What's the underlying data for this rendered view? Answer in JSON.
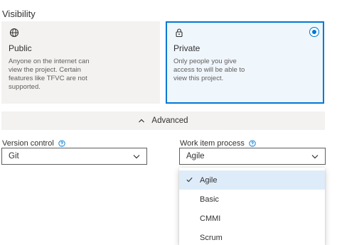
{
  "visibility": {
    "title": "Visibility",
    "public": {
      "title": "Public",
      "icon": "globe-icon",
      "description": "Anyone on the internet can view the project. Certain features like TFVC are not supported."
    },
    "private": {
      "title": "Private",
      "icon": "lock-icon",
      "description": "Only people you give access to will be able to view this project.",
      "selected": true
    }
  },
  "advanced": {
    "label": "Advanced",
    "icon": "chevron-up-icon"
  },
  "version_control": {
    "label": "Version control",
    "value": "Git"
  },
  "work_item_process": {
    "label": "Work item process",
    "value": "Agile",
    "options": [
      "Agile",
      "Basic",
      "CMMI",
      "Scrum"
    ],
    "selected_index": 0
  },
  "colors": {
    "accent": "#0078d4",
    "selected_option_bg": "#deecf9",
    "card_bg": "#f3f2f1"
  }
}
